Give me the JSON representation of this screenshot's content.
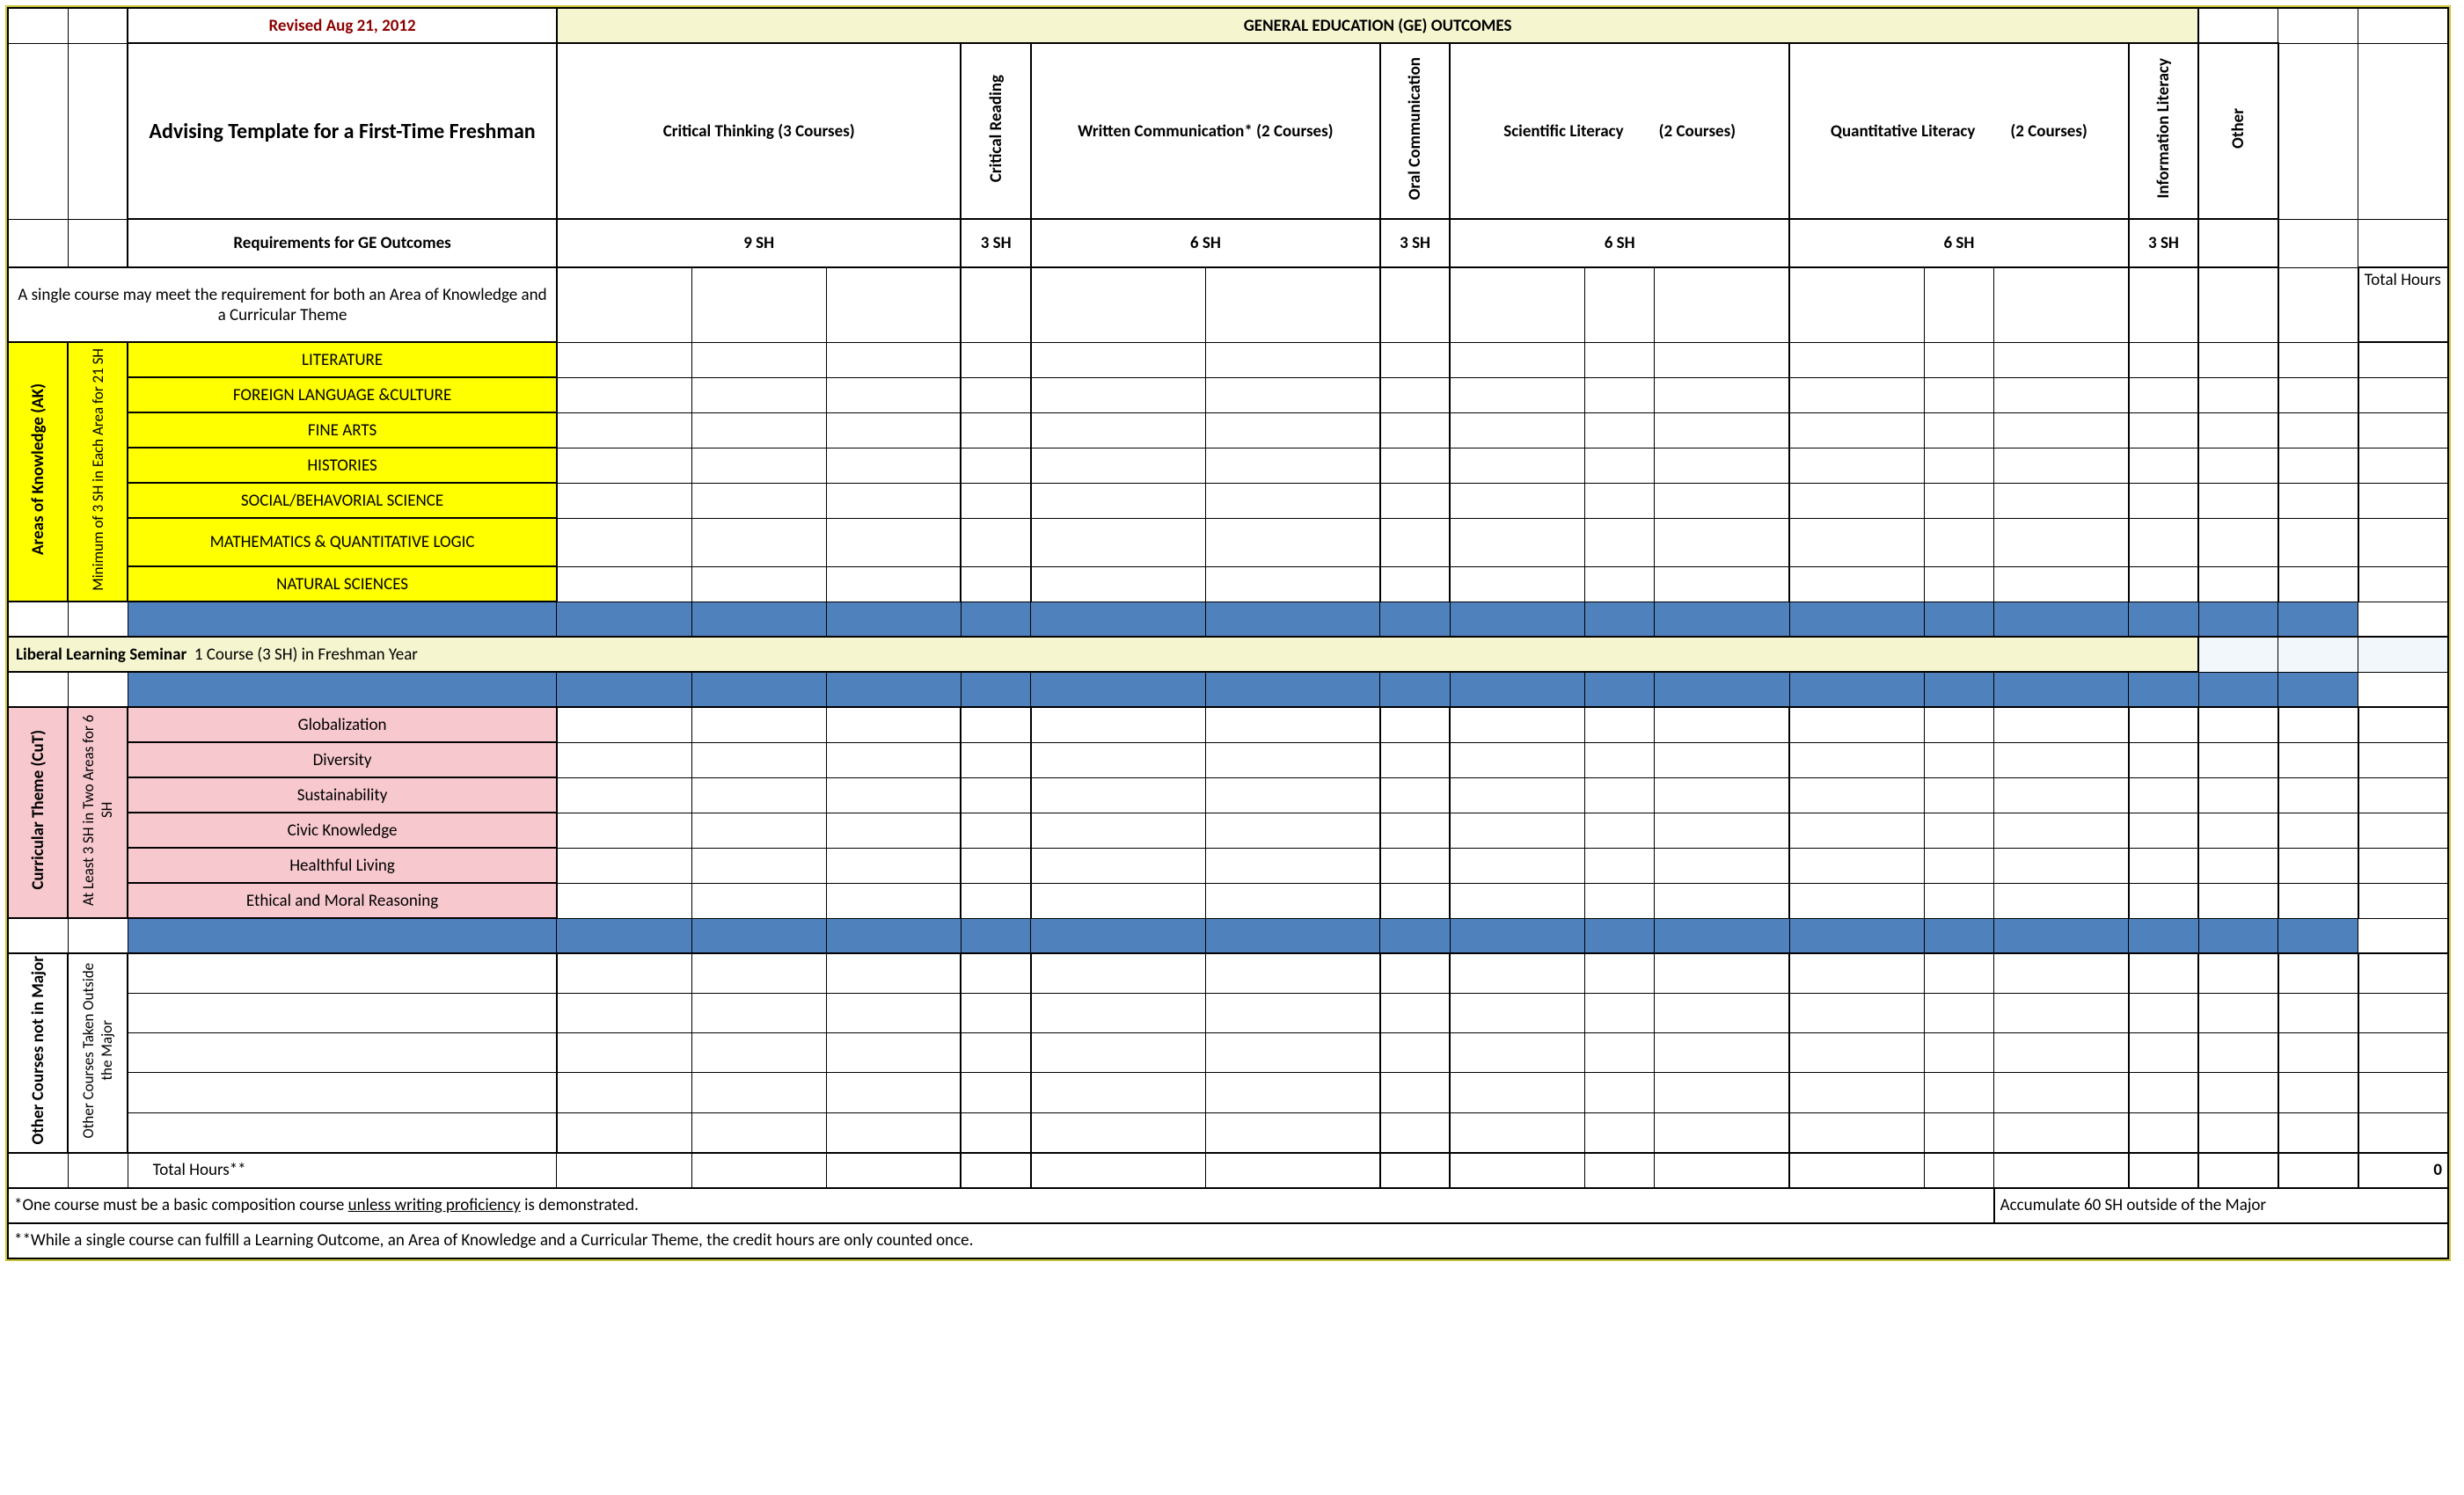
{
  "hdr": {
    "revised": "Revised Aug 21, 2012",
    "ge_outcomes": "GENERAL EDUCATION (GE) OUTCOMES",
    "title": "Advising Template for a First-Time Freshman",
    "req": "Requirements for GE Outcomes",
    "crit_think": "Critical Thinking (3 Courses)",
    "crit_read": "Critical Reading",
    "written": "Written Communication*  (2 Courses)",
    "oral": "Oral Communication",
    "sci_a": "Scientific Literacy",
    "sci_b": "(2 Courses)",
    "quant_a": "Quantitative Literacy",
    "quant_b": "(2 Courses)",
    "info": "Information Literacy",
    "other": "Other",
    "sh9": "9 SH",
    "sh3a": "3 SH",
    "sh6a": "6 SH",
    "sh3b": "3 SH",
    "sh6b": "6 SH",
    "sh6c": "6 SH",
    "sh3c": "3 SH"
  },
  "note1": "A single course may meet the requirement for both an Area of Knowledge and a Curricular Theme",
  "total_hours_label": "Total Hours",
  "ak": {
    "side": "Areas of Knowledge (AK)",
    "min": "Minimum of 3 SH in Each Area for 21 SH",
    "rows": [
      "LITERATURE",
      "FOREIGN LANGUAGE &CULTURE",
      "FINE ARTS",
      "HISTORIES",
      "SOCIAL/BEHAVORIAL SCIENCE",
      "MATHEMATICS & QUANTITATIVE LOGIC",
      "NATURAL SCIENCES"
    ]
  },
  "lls_label": "Liberal Learning Seminar",
  "lls_detail": "1 Course (3 SH) in Freshman Year",
  "cut": {
    "side": "Curricular Theme (CuT)",
    "min": "At Least 3 SH in Two Areas for 6 SH",
    "rows": [
      "Globalization",
      "Diversity",
      "Sustainability",
      "Civic Knowledge",
      "Healthful Living",
      "Ethical and Moral Reasoning"
    ]
  },
  "oc": {
    "side": "Other Courses not in Major",
    "min": "Other Courses Taken Outside the Major"
  },
  "totals": "Total Hours**",
  "zero": "0",
  "fn1a": "*One course must be a basic composition course ",
  "fn1b": "unless writing proficiency",
  "fn1c": " is demonstrated.",
  "fn1r": "Accumulate 60 SH outside of the Major",
  "fn2": "**While a single course can fulfill a Learning Outcome, an Area of Knowledge and a Curricular Theme, the credit hours are only counted once."
}
